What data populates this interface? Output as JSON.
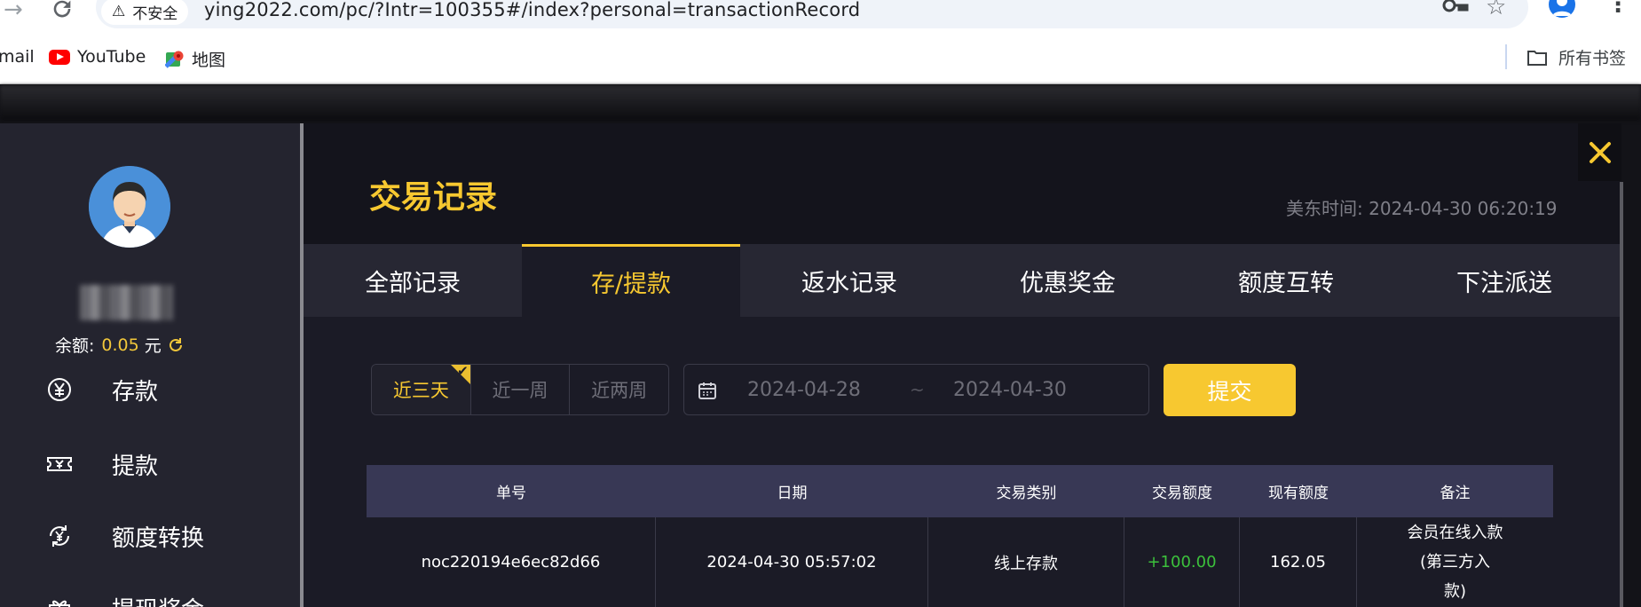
{
  "browser": {
    "security_label": "不安全",
    "url": "ying2022.com/pc/?Intr=100355#/index?personal=transactionRecord"
  },
  "bookmarks": {
    "gmail": "mail",
    "youtube": "YouTube",
    "maps": "地图",
    "all_bookmarks": "所有书签"
  },
  "sidebar": {
    "balance_label": "余额:",
    "balance_amount": "0.05",
    "balance_unit": "元",
    "items": [
      {
        "label": "存款",
        "icon": "yen-coin-icon"
      },
      {
        "label": "提款",
        "icon": "ticket-icon"
      },
      {
        "label": "额度转换",
        "icon": "yen-transfer-icon"
      },
      {
        "label": "提现奖金",
        "icon": "gift-icon"
      }
    ]
  },
  "modal": {
    "title": "交易记录",
    "time_label": "美东时间: 2024-04-30 06:20:19",
    "tabs": [
      "全部记录",
      "存/提款",
      "返水记录",
      "优惠奖金",
      "额度互转",
      "下注派送"
    ],
    "active_tab": 1
  },
  "filters": {
    "ranges": [
      "近三天",
      "近一周",
      "近两周"
    ],
    "active_range": 0,
    "date_start": "2024-04-28",
    "date_separator": "~",
    "date_end": "2024-04-30",
    "submit_label": "提交"
  },
  "table": {
    "headers": [
      "单号",
      "日期",
      "交易类别",
      "交易额度",
      "现有额度",
      "备注"
    ],
    "rows": [
      {
        "order_no": "noc220194e6ec82d66",
        "date": "2024-04-30 05:57:02",
        "category": "线上存款",
        "amount": "+100.00",
        "balance": "162.05",
        "note_lines": [
          "会员在线入款",
          "(第三方入",
          "款)"
        ]
      }
    ]
  },
  "colors": {
    "accent": "#f7c830",
    "positive": "#3cc13c",
    "modal_bg": "#1b1b26",
    "header_row": "#383855"
  }
}
